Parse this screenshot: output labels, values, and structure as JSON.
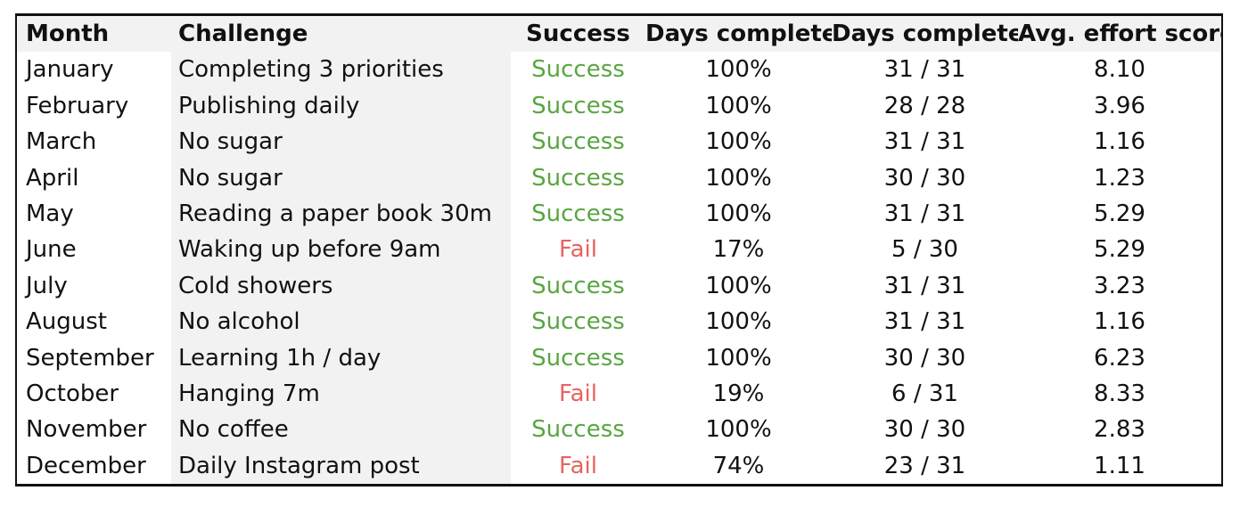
{
  "table": {
    "columns": [
      {
        "key": "month",
        "label": "Month"
      },
      {
        "key": "challenge",
        "label": "Challenge"
      },
      {
        "key": "success",
        "label": "Success"
      },
      {
        "key": "percent",
        "label": "Days completed"
      },
      {
        "key": "days",
        "label": "Days completed"
      },
      {
        "key": "effort",
        "label": "Avg. effort score"
      }
    ],
    "colors": {
      "success": "#5aa543",
      "fail": "#e8635e",
      "header_background": "#f2f2f2",
      "challenge_column_background": "#f2f2f2",
      "border": "#111111",
      "text": "#111111"
    },
    "rows": [
      {
        "month": "January",
        "challenge": "Completing 3 priorities",
        "success": "Success",
        "status": "success",
        "percent": "100%",
        "days": "31 / 31",
        "effort": "8.10"
      },
      {
        "month": "February",
        "challenge": "Publishing daily",
        "success": "Success",
        "status": "success",
        "percent": "100%",
        "days": "28 / 28",
        "effort": "3.96"
      },
      {
        "month": "March",
        "challenge": "No sugar",
        "success": "Success",
        "status": "success",
        "percent": "100%",
        "days": "31 / 31",
        "effort": "1.16"
      },
      {
        "month": "April",
        "challenge": "No sugar",
        "success": "Success",
        "status": "success",
        "percent": "100%",
        "days": "30 / 30",
        "effort": "1.23"
      },
      {
        "month": "May",
        "challenge": "Reading a paper book 30m",
        "success": "Success",
        "status": "success",
        "percent": "100%",
        "days": "31 / 31",
        "effort": "5.29"
      },
      {
        "month": "June",
        "challenge": "Waking up before 9am",
        "success": "Fail",
        "status": "fail",
        "percent": "17%",
        "days": "5 / 30",
        "effort": "5.29"
      },
      {
        "month": "July",
        "challenge": "Cold showers",
        "success": "Success",
        "status": "success",
        "percent": "100%",
        "days": "31 / 31",
        "effort": "3.23"
      },
      {
        "month": "August",
        "challenge": "No alcohol",
        "success": "Success",
        "status": "success",
        "percent": "100%",
        "days": "31 / 31",
        "effort": "1.16"
      },
      {
        "month": "September",
        "challenge": "Learning 1h / day",
        "success": "Success",
        "status": "success",
        "percent": "100%",
        "days": "30 / 30",
        "effort": "6.23"
      },
      {
        "month": "October",
        "challenge": "Hanging 7m",
        "success": "Fail",
        "status": "fail",
        "percent": "19%",
        "days": "6 / 31",
        "effort": "8.33"
      },
      {
        "month": "November",
        "challenge": "No coffee",
        "success": "Success",
        "status": "success",
        "percent": "100%",
        "days": "30 / 30",
        "effort": "2.83"
      },
      {
        "month": "December",
        "challenge": "Daily Instagram post",
        "success": "Fail",
        "status": "fail",
        "percent": "74%",
        "days": "23 / 31",
        "effort": "1.11"
      }
    ]
  }
}
